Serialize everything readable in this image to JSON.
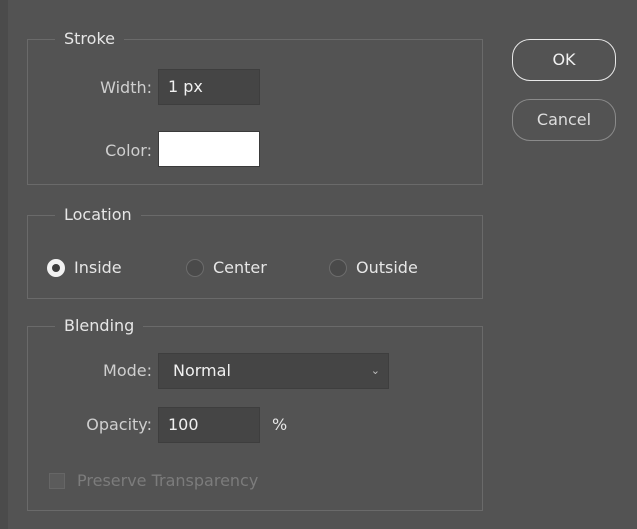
{
  "stroke": {
    "legend": "Stroke",
    "width_label": "Width:",
    "width_value": "1 px",
    "color_label": "Color:",
    "color_value": "#ffffff"
  },
  "location": {
    "legend": "Location",
    "options": [
      {
        "label": "Inside",
        "selected": true
      },
      {
        "label": "Center",
        "selected": false
      },
      {
        "label": "Outside",
        "selected": false
      }
    ]
  },
  "blending": {
    "legend": "Blending",
    "mode_label": "Mode:",
    "mode_value": "Normal",
    "opacity_label": "Opacity:",
    "opacity_value": "100",
    "opacity_unit": "%",
    "preserve_label": "Preserve Transparency",
    "preserve_checked": false,
    "preserve_enabled": false
  },
  "buttons": {
    "ok_label": "OK",
    "cancel_label": "Cancel"
  }
}
